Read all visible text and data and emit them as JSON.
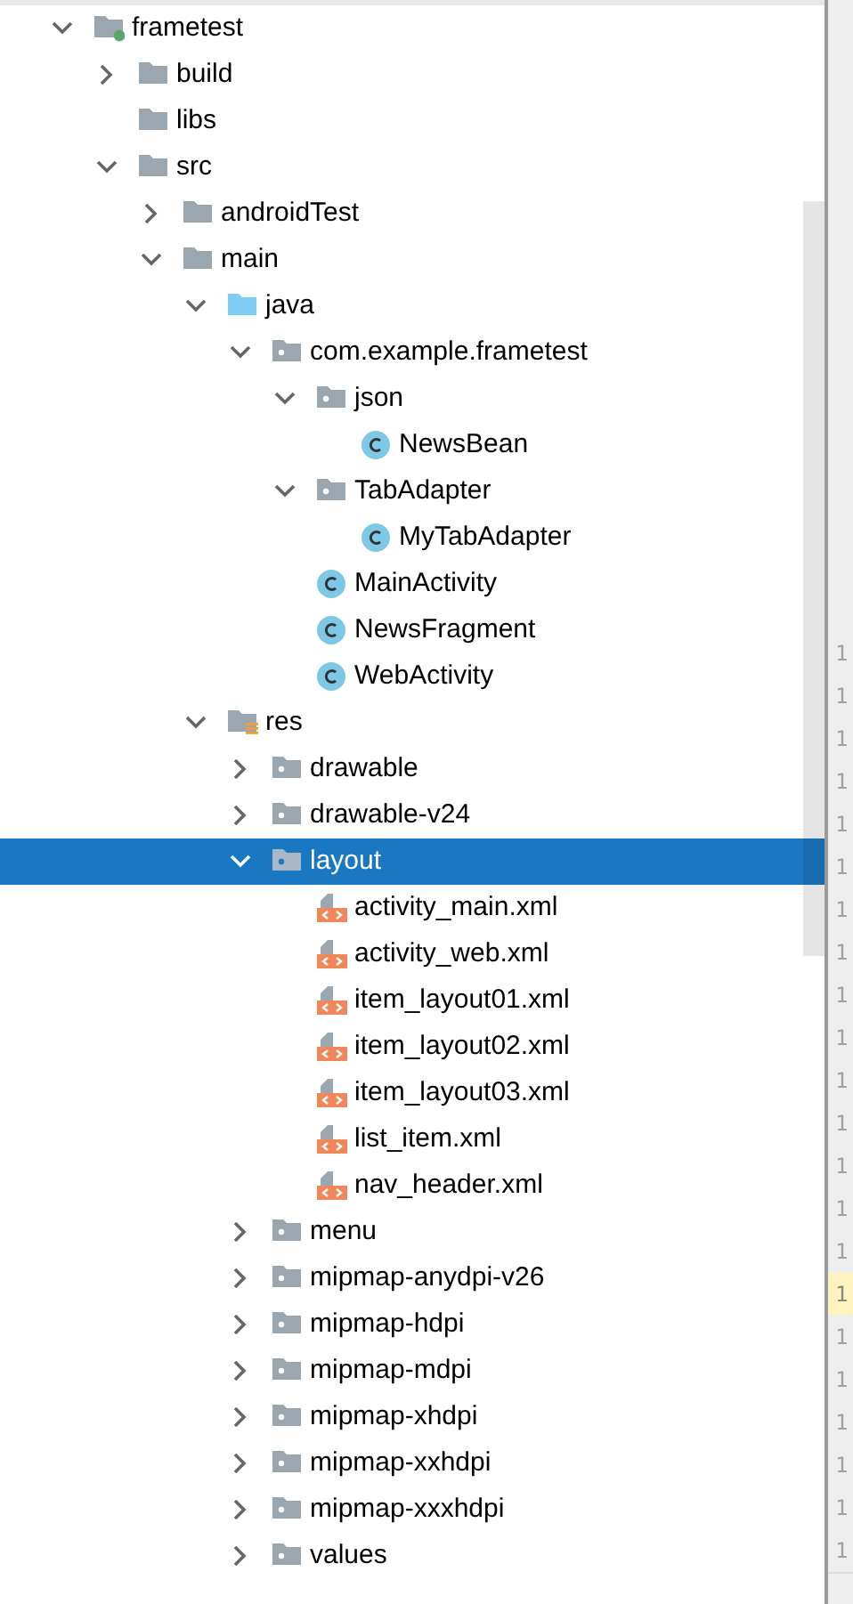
{
  "project_tree": {
    "items": [
      {
        "label": "frametest",
        "kind": "module",
        "expanded": true,
        "selected": false,
        "children": [
          {
            "label": "build",
            "kind": "folder",
            "expanded": false,
            "selected": false
          },
          {
            "label": "libs",
            "kind": "folder",
            "selected": false
          },
          {
            "label": "src",
            "kind": "folder",
            "expanded": true,
            "selected": false,
            "children": [
              {
                "label": "androidTest",
                "kind": "folder",
                "expanded": false,
                "selected": false
              },
              {
                "label": "main",
                "kind": "folder",
                "expanded": true,
                "selected": false,
                "children": [
                  {
                    "label": "java",
                    "kind": "source-folder",
                    "expanded": true,
                    "selected": false,
                    "children": [
                      {
                        "label": "com.example.frametest",
                        "kind": "package",
                        "expanded": true,
                        "selected": false,
                        "children": [
                          {
                            "label": "json",
                            "kind": "package",
                            "expanded": true,
                            "selected": false,
                            "children": [
                              {
                                "label": "NewsBean",
                                "kind": "class",
                                "selected": false
                              }
                            ]
                          },
                          {
                            "label": "TabAdapter",
                            "kind": "package",
                            "expanded": true,
                            "selected": false,
                            "children": [
                              {
                                "label": "MyTabAdapter",
                                "kind": "class",
                                "selected": false
                              }
                            ]
                          },
                          {
                            "label": "MainActivity",
                            "kind": "class",
                            "selected": false
                          },
                          {
                            "label": "NewsFragment",
                            "kind": "class",
                            "selected": false
                          },
                          {
                            "label": "WebActivity",
                            "kind": "class",
                            "selected": false
                          }
                        ]
                      }
                    ]
                  },
                  {
                    "label": "res",
                    "kind": "resource-folder",
                    "expanded": true,
                    "selected": false,
                    "children": [
                      {
                        "label": "drawable",
                        "kind": "package",
                        "expanded": false,
                        "selected": false
                      },
                      {
                        "label": "drawable-v24",
                        "kind": "package",
                        "expanded": false,
                        "selected": false
                      },
                      {
                        "label": "layout",
                        "kind": "package",
                        "expanded": true,
                        "selected": true,
                        "children": [
                          {
                            "label": "activity_main.xml",
                            "kind": "layout-file",
                            "selected": false
                          },
                          {
                            "label": "activity_web.xml",
                            "kind": "layout-file",
                            "selected": false
                          },
                          {
                            "label": "item_layout01.xml",
                            "kind": "layout-file",
                            "selected": false
                          },
                          {
                            "label": "item_layout02.xml",
                            "kind": "layout-file",
                            "selected": false
                          },
                          {
                            "label": "item_layout03.xml",
                            "kind": "layout-file",
                            "selected": false
                          },
                          {
                            "label": "list_item.xml",
                            "kind": "layout-file",
                            "selected": false
                          },
                          {
                            "label": "nav_header.xml",
                            "kind": "layout-file",
                            "selected": false
                          }
                        ]
                      },
                      {
                        "label": "menu",
                        "kind": "package",
                        "expanded": false,
                        "selected": false
                      },
                      {
                        "label": "mipmap-anydpi-v26",
                        "kind": "package",
                        "expanded": false,
                        "selected": false
                      },
                      {
                        "label": "mipmap-hdpi",
                        "kind": "package",
                        "expanded": false,
                        "selected": false
                      },
                      {
                        "label": "mipmap-mdpi",
                        "kind": "package",
                        "expanded": false,
                        "selected": false
                      },
                      {
                        "label": "mipmap-xhdpi",
                        "kind": "package",
                        "expanded": false,
                        "selected": false
                      },
                      {
                        "label": "mipmap-xxhdpi",
                        "kind": "package",
                        "expanded": false,
                        "selected": false
                      },
                      {
                        "label": "mipmap-xxxhdpi",
                        "kind": "package",
                        "expanded": false,
                        "selected": false
                      },
                      {
                        "label": "values",
                        "kind": "package",
                        "expanded": false,
                        "selected": false
                      }
                    ]
                  }
                ]
              }
            ]
          }
        ]
      }
    ]
  },
  "gutter": {
    "line_numbers": [
      {
        "text": "1",
        "current": false
      },
      {
        "text": "1",
        "current": false
      },
      {
        "text": "1",
        "current": false
      },
      {
        "text": "1",
        "current": false
      },
      {
        "text": "1",
        "current": false
      },
      {
        "text": "1",
        "current": false
      },
      {
        "text": "1",
        "current": false
      },
      {
        "text": "1",
        "current": false
      },
      {
        "text": "1",
        "current": false
      },
      {
        "text": "1",
        "current": false
      },
      {
        "text": "1",
        "current": false
      },
      {
        "text": "1",
        "current": false
      },
      {
        "text": "1",
        "current": false
      },
      {
        "text": "1",
        "current": false
      },
      {
        "text": "1",
        "current": false
      },
      {
        "text": "1",
        "current": true
      },
      {
        "text": "1",
        "current": false
      },
      {
        "text": "1",
        "current": false
      },
      {
        "text": "1",
        "current": false
      },
      {
        "text": "1",
        "current": false
      },
      {
        "text": "1",
        "current": false
      },
      {
        "text": "1",
        "current": false
      }
    ]
  }
}
